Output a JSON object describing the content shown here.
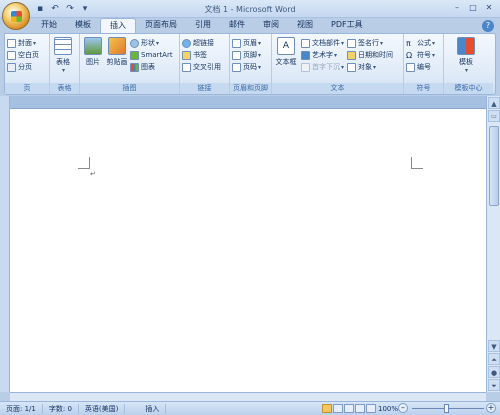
{
  "window": {
    "title": "文档 1 - Microsoft Word"
  },
  "qat": [
    "save-icon",
    "undo-icon",
    "redo-icon",
    "customize-icon"
  ],
  "tabs": [
    {
      "label": "开始"
    },
    {
      "label": "模板"
    },
    {
      "label": "插入"
    },
    {
      "label": "页面布局"
    },
    {
      "label": "引用"
    },
    {
      "label": "邮件"
    },
    {
      "label": "审阅"
    },
    {
      "label": "视图"
    },
    {
      "label": "PDF工具"
    }
  ],
  "active_tab": "插入",
  "ribbon": {
    "page": {
      "label": "页",
      "items": [
        "封面",
        "空白页",
        "分页"
      ]
    },
    "table": {
      "label": "表格",
      "button": "表格"
    },
    "illustrations": {
      "label": "插图",
      "picture": "图片",
      "clipart": "剪贴画",
      "shapes": "形状",
      "smartart": "SmartArt",
      "chart": "图表"
    },
    "links": {
      "label": "链接",
      "items": [
        "超链接",
        "书签",
        "交叉引用"
      ]
    },
    "header_footer": {
      "label": "页眉和页脚",
      "items": [
        "页眉",
        "页脚",
        "页码"
      ]
    },
    "text": {
      "label": "文本",
      "textbox": "文本框",
      "items": [
        "文档部件",
        "艺术字",
        "首字下沉"
      ],
      "items2": [
        "签名行",
        "日期和时间",
        "对象"
      ]
    },
    "symbols": {
      "label": "符号",
      "items": [
        "公式",
        "符号",
        "编号"
      ]
    },
    "template_center": {
      "label": "模板中心",
      "button": "模板"
    }
  },
  "status": {
    "page": "页面: 1/1",
    "words": "字数: 0",
    "language": "英语(美国)",
    "mode": "插入",
    "zoom": "100%"
  }
}
